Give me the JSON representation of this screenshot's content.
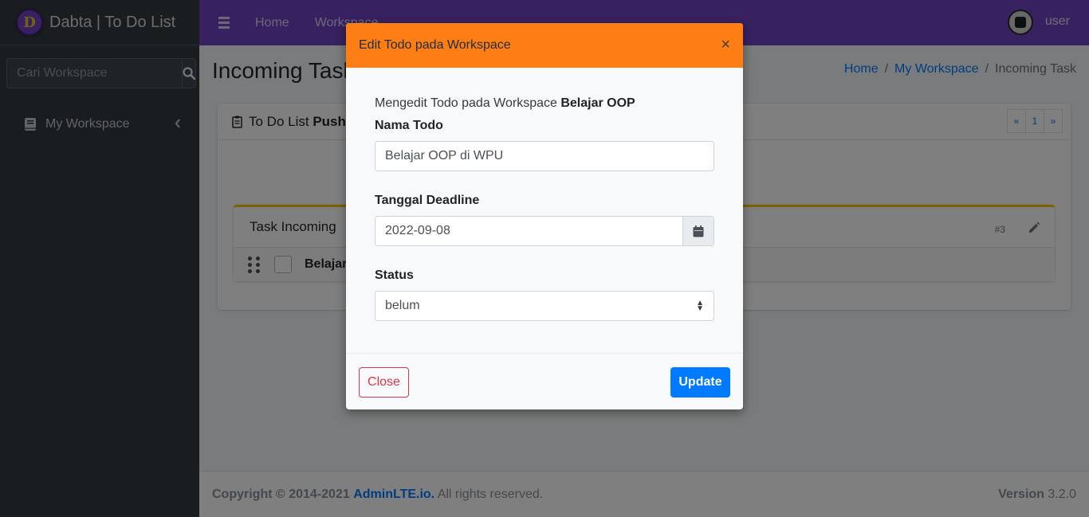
{
  "brand": {
    "logo_letter": "D",
    "name": "Dabta | To Do List"
  },
  "sidebar": {
    "search_placeholder": "Cari Workspace",
    "items": [
      {
        "label": "My Workspace",
        "icon": "book-icon"
      }
    ]
  },
  "topnav": {
    "links": [
      "Home",
      "Workspace"
    ],
    "user": "user"
  },
  "page": {
    "title": "Incoming Task",
    "breadcrumb": [
      "Home",
      "My Workspace",
      "Incoming Task"
    ]
  },
  "card": {
    "title_prefix": "To Do List",
    "title_bold": "Push R",
    "pager": [
      "«",
      "1",
      "»"
    ],
    "inner_title": "Task Incoming",
    "inner_number": "#3",
    "todo_text": "Belajar O"
  },
  "footer": {
    "copyright": "Copyright © 2014-2021",
    "link": "AdminLTE.io.",
    "rights": "All rights reserved.",
    "version_label": "Version",
    "version": "3.2.0"
  },
  "modal": {
    "title": "Edit Todo pada Workspace",
    "close_glyph": "×",
    "intro": "Mengedit Todo pada Workspace",
    "workspace_name": "Belajar OOP",
    "name_label": "Nama Todo",
    "name_value": "Belajar OOP di WPU",
    "deadline_label": "Tanggal Deadline",
    "deadline_value": "2022-09-08",
    "status_label": "Status",
    "status_value": "belum",
    "close_button": "Close",
    "update_button": "Update"
  },
  "colors": {
    "navbar": "#6f42c1",
    "sidebar": "#343a40",
    "modal_header": "#fd7e14",
    "primary": "#007bff",
    "danger": "#dc3545"
  }
}
